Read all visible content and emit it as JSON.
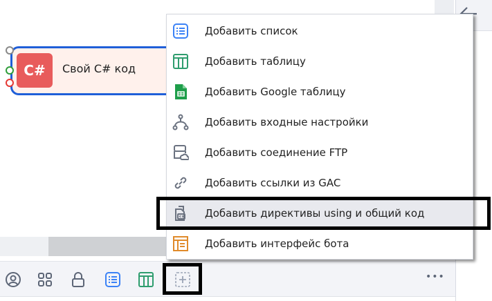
{
  "node": {
    "badge": "C#",
    "label": "Свой C# код"
  },
  "menu": {
    "items": [
      {
        "label": "Добавить список",
        "icon": "list-icon"
      },
      {
        "label": "Добавить таблицу",
        "icon": "table-icon"
      },
      {
        "label": "Добавить Google таблицу",
        "icon": "google-sheets-icon"
      },
      {
        "label": "Добавить входные настройки",
        "icon": "input-settings-icon"
      },
      {
        "label": "Добавить соединение FTP",
        "icon": "ftp-icon"
      },
      {
        "label": "Добавить ссылки из GAC",
        "icon": "link-icon"
      },
      {
        "label": "Добавить директивы using и общий код",
        "icon": "code-file-icon"
      },
      {
        "label": "Добавить интерфейс бота",
        "icon": "bot-interface-icon"
      }
    ],
    "highlighted_index": 6
  },
  "toolbar": {
    "more_label": "•••"
  },
  "colors": {
    "accent": "#1f5fd8",
    "badge": "#e85c5c",
    "blue": "#3b82f6",
    "green": "#2e9d6e",
    "orange": "#e08a2a",
    "gray": "#6b7280"
  }
}
